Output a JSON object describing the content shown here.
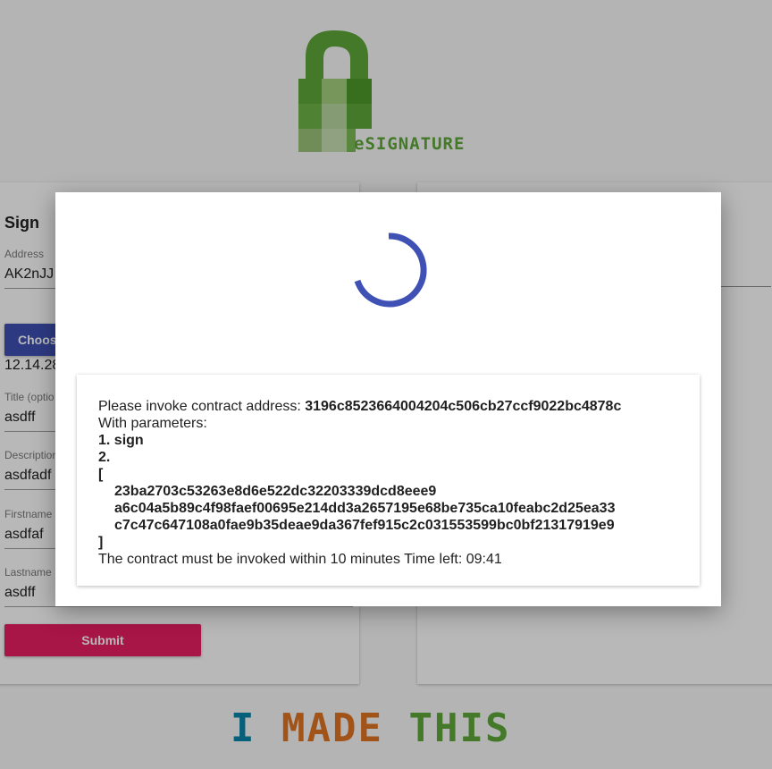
{
  "logo": {
    "text": "eSIGNATURE"
  },
  "sign_form": {
    "title": "Sign",
    "address_label": "Address",
    "address_value": "AK2nJJ",
    "choose_button": "Choos",
    "file_info": "12.14.28",
    "title_label": "Title (optio",
    "title_value": "asdff",
    "description_label": "Description",
    "description_value": "asdfadf",
    "firstname_label": "Firstname",
    "firstname_value": "asdfaf",
    "lastname_label": "Lastname",
    "lastname_value": "asdff",
    "submit_button": "Submit"
  },
  "footer": {
    "i": "I",
    "made": "MADE",
    "this": "THIS"
  },
  "modal": {
    "invoke_prefix": "Please invoke contract address: ",
    "contract_address": "3196c8523664004204c506cb27ccf9022bc4878c",
    "params_label": "With parameters:",
    "param1": "1. sign",
    "param2": "2.",
    "bracket_open": "[",
    "hashes": [
      "23ba2703c53263e8d6e522dc32203339dcd8eee9",
      "a6c04a5b89c4f98faef00695e214dd3a2657195e68be735ca10feabc2d25ea33",
      "c7c47c647108a0fae9b35deae9da367fef915c2c031553599bc0bf21317919e9"
    ],
    "bracket_close": "]",
    "deadline_text": "The contract must be invoked within 10 minutes Time left: 09:41"
  },
  "colors": {
    "primary": "#3f51b5",
    "accent": "#e91e63",
    "logo_green": "#5fa83a"
  }
}
